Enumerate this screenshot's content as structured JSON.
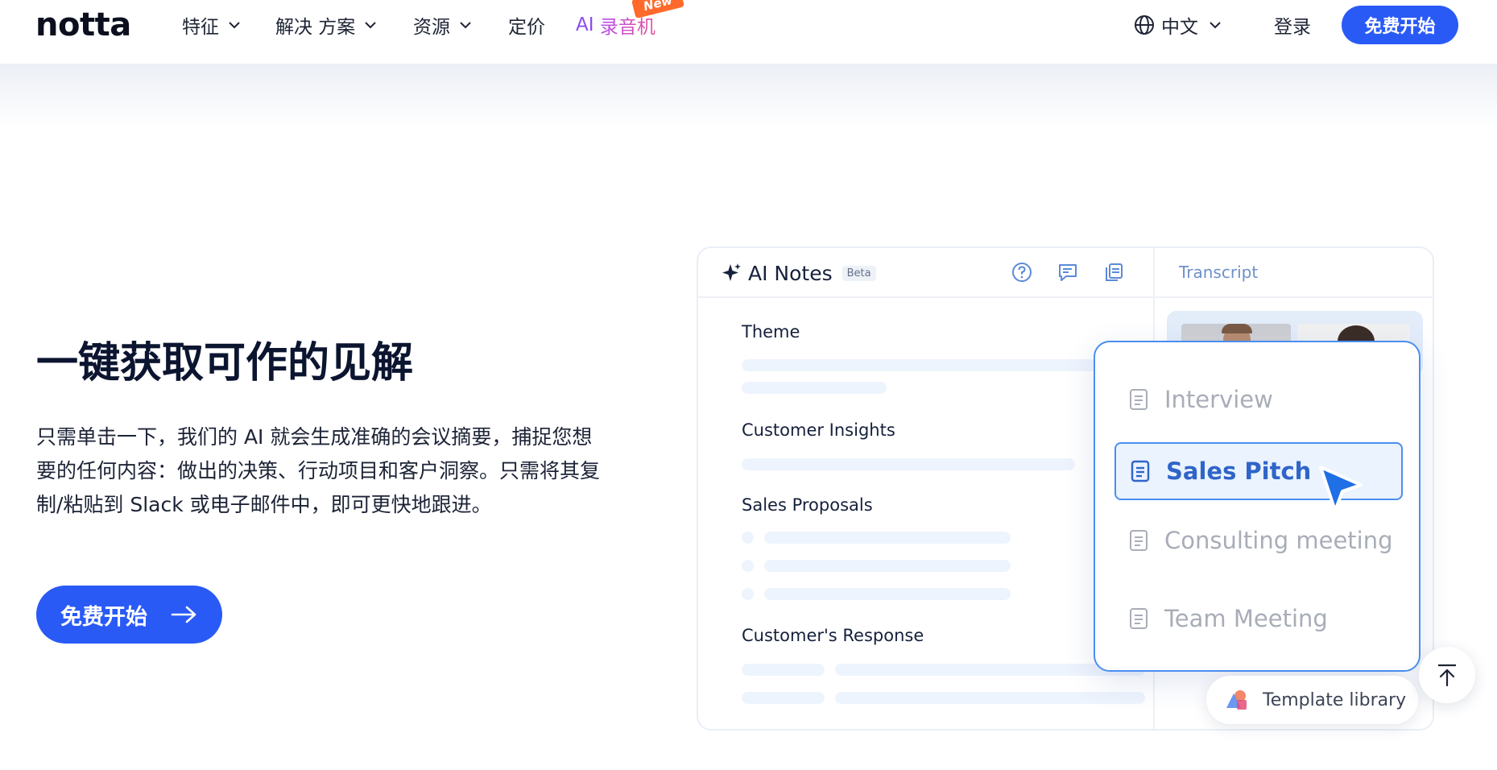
{
  "header": {
    "logo": "notta",
    "nav": [
      {
        "label": "特征"
      },
      {
        "label": "解决 方案"
      },
      {
        "label": "资源"
      },
      {
        "label": "定价"
      }
    ],
    "ai_nav": {
      "prefix": "AI",
      "label": "录音机",
      "badge": "New"
    },
    "language": "中文",
    "login": "登录",
    "cta": "免费开始"
  },
  "hero": {
    "title": "一键获取可作的见解",
    "description": "只需单击一下，我们的 AI 就会生成准确的会议摘要，捕捉您想要的任何内容：做出的决策、行动项目和客户洞察。只需将其复制/粘贴到 Slack 或电子邮件中，即可更快地跟进。",
    "cta": "免费开始"
  },
  "notes_card": {
    "title": "AI Notes",
    "badge": "Beta",
    "transcript_tab": "Transcript",
    "sections": [
      "Theme",
      "Customer Insights",
      "Sales Proposals",
      "Customer's Response"
    ]
  },
  "template_dropdown": {
    "items": [
      "Interview",
      "Sales Pitch",
      "Consulting meeting",
      "Team Meeting"
    ],
    "selected": "Sales Pitch"
  },
  "template_library": "Template library",
  "colors": {
    "brand": "#2a5af6",
    "ai_gradient_start": "#b44bf0",
    "ai_gradient_end": "#e8529a",
    "new_badge": "#ff6a2b",
    "dropdown_border": "#4a8ff0",
    "selected_text": "#2f64c8"
  },
  "icons": [
    "chevron-down-icon",
    "globe-icon",
    "arrow-right-icon",
    "sparkle-icon",
    "help-icon",
    "comment-edit-icon",
    "copy-icon",
    "document-icon",
    "cursor-pointer-icon",
    "template-library-icon",
    "arrow-up-icon"
  ]
}
